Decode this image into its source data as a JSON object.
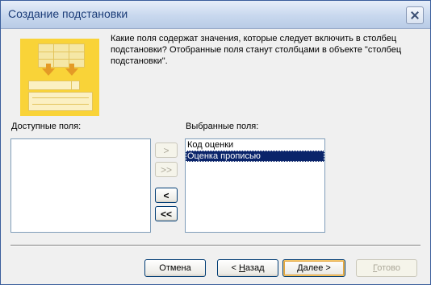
{
  "window": {
    "title": "Создание подстановки"
  },
  "header": {
    "description": "Какие поля содержат значения, которые следует включить в столбец\nподстановки? Отобранные поля станут столбцами в объекте \"столбец\nподстановки\".",
    "wizard_icon": "wizard-illustration"
  },
  "available_fields": {
    "label": "Доступные поля:",
    "items": []
  },
  "selected_fields": {
    "label": "Выбранные поля:",
    "items": [
      {
        "label": "Код оценки",
        "selected": false
      },
      {
        "label": "Оценка прописью",
        "selected": true
      }
    ]
  },
  "move_buttons": {
    "add_one": ">",
    "add_all": ">>",
    "remove_one": "<",
    "remove_all": "<<"
  },
  "footer": {
    "cancel": "Отмена",
    "back_prefix": "< ",
    "back_hotkey": "Н",
    "back_suffix": "азад",
    "next_hotkey": "Д",
    "next_suffix": "алее >",
    "finish_hotkey": "Г",
    "finish_suffix": "отово"
  },
  "colors": {
    "selection": "#0a246a",
    "wizard_yellow": "#f9d338",
    "wizard_orange": "#e49a26"
  }
}
